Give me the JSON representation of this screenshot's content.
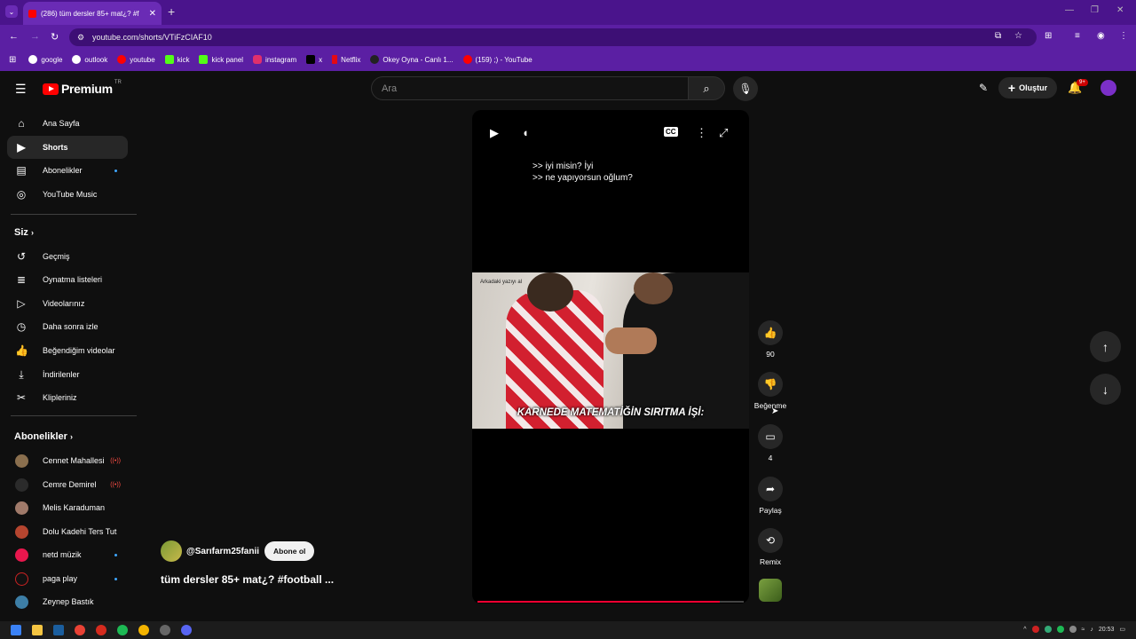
{
  "browser": {
    "tab_title": "(286) tüm dersler 85+ mat¿? #f",
    "url": "youtube.com/shorts/VTiFzCIAF10",
    "bookmarks": [
      "google",
      "outlook",
      "youtube",
      "kick",
      "kick panel",
      "instagram",
      "x",
      "Netflix",
      "Okey Oyna - Canlı 1...",
      "(159) ;) - YouTube"
    ],
    "bookmark_colors": [
      "#ffffff",
      "#ffffff",
      "#ff0000",
      "#53fc18",
      "#53fc18",
      "#e1306c",
      "#000000",
      "#e50914",
      "#ffffff",
      "#ff0000"
    ]
  },
  "masthead": {
    "logo": "Premium",
    "country": "TR",
    "search_placeholder": "Ara",
    "create_label": "Oluştur",
    "notif_badge": "9+"
  },
  "sidebar": {
    "main": [
      "Ana Sayfa",
      "Shorts",
      "Abonelikler",
      "YouTube Music"
    ],
    "you_heading": "Siz",
    "you": [
      "Geçmiş",
      "Oynatma listeleri",
      "Videolarınız",
      "Daha sonra izle",
      "Beğendiğim videolar",
      "İndirilenler",
      "Klipleriniz"
    ],
    "subs_heading": "Abonelikler",
    "subs": [
      "Cennet Mahallesi",
      "Cemre Demirel",
      "Melis Karaduman",
      "Dolu Kadehi Ters Tut",
      "netd müzik",
      "paga play",
      "Zeynep Bastık"
    ]
  },
  "player": {
    "caption_line1": ">> iyi misin? İyi",
    "caption_line2": ">> ne yapıyorsun oğlum?",
    "frame_top_text": "Arkadaki yazıyı al",
    "frame_caption": "KARNEDE MATEMATİĞİN SIRITMA İŞİ:",
    "progress": 0.91
  },
  "actions": {
    "likes": "90",
    "dislike_label": "Beğenme",
    "comments": "4",
    "share_label": "Paylaş",
    "remix_label": "Remix"
  },
  "channel": {
    "handle": "@Sarıfarm25fanii",
    "subscribe_label": "Abone ol",
    "title": "tüm dersler 85+ mat¿? #football ..."
  },
  "taskbar": {
    "time": "20:53"
  }
}
